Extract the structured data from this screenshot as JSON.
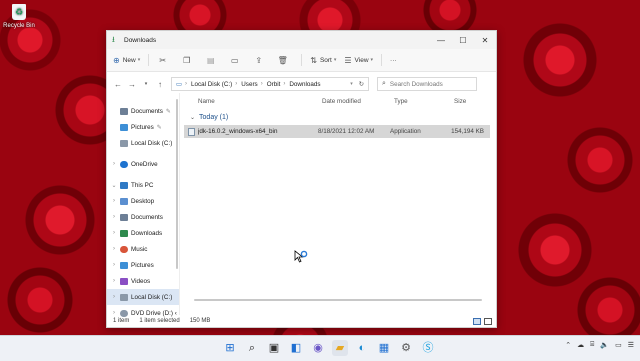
{
  "desktop": {
    "recycle_bin_label": "Recycle Bin"
  },
  "window": {
    "title": "Downloads",
    "controls": {
      "minimize": "—",
      "maximize": "☐",
      "close": "✕"
    }
  },
  "toolbar": {
    "new_label": "New",
    "sort_label": "Sort",
    "view_label": "View",
    "more": "···"
  },
  "address": {
    "segments": [
      "Local Disk (C:)",
      "Users",
      "Orbit",
      "Downloads"
    ],
    "search_placeholder": "Search Downloads"
  },
  "sidebar": {
    "items": [
      {
        "label": "Documents",
        "icon": "documents-icon",
        "color": "#6d7f96",
        "pinned": true
      },
      {
        "label": "Pictures",
        "icon": "pictures-icon",
        "color": "#3d8fd6",
        "pinned": true
      },
      {
        "label": "Local Disk (C:)",
        "icon": "drive-icon",
        "color": "#8a98a8",
        "pinned": false
      },
      {
        "label": "OneDrive",
        "icon": "onedrive-icon",
        "color": "#1e73cf"
      },
      {
        "label": "This PC",
        "icon": "computer-icon",
        "color": "#2f79c4"
      },
      {
        "label": "Desktop",
        "icon": "desktop-icon",
        "color": "#5b8fd0"
      },
      {
        "label": "Documents",
        "icon": "documents-icon",
        "color": "#6d7f96"
      },
      {
        "label": "Downloads",
        "icon": "downloads-icon",
        "color": "#2f8a4e"
      },
      {
        "label": "Music",
        "icon": "music-icon",
        "color": "#d8553a"
      },
      {
        "label": "Pictures",
        "icon": "pictures-icon",
        "color": "#3d8fd6"
      },
      {
        "label": "Videos",
        "icon": "videos-icon",
        "color": "#8a4fc4"
      },
      {
        "label": "Local Disk (C:)",
        "icon": "drive-icon",
        "color": "#8a98a8"
      },
      {
        "label": "DVD Drive (D:) ‹",
        "icon": "dvd-icon",
        "color": "#8a98a8"
      }
    ]
  },
  "columns": {
    "name": "Name",
    "date": "Date modified",
    "type": "Type",
    "size": "Size"
  },
  "group": {
    "label": "Today (1)"
  },
  "files": [
    {
      "name": "jdk-16.0.2_windows-x64_bin",
      "date": "8/18/2021 12:02 AM",
      "type": "Application",
      "size": "154,194 KB"
    }
  ],
  "status": {
    "count": "1 item",
    "selected": "1 item selected",
    "size": "150 MB"
  },
  "taskbar": {
    "apps": [
      {
        "name": "start-icon",
        "glyph": "⊞",
        "color": "#1f6fd1"
      },
      {
        "name": "search-icon",
        "glyph": "⌕",
        "color": "#222222"
      },
      {
        "name": "task-view-icon",
        "glyph": "▣",
        "color": "#333333"
      },
      {
        "name": "widgets-icon",
        "glyph": "◧",
        "color": "#1f6fd1"
      },
      {
        "name": "chat-icon",
        "glyph": "◉",
        "color": "#6b57c7"
      },
      {
        "name": "file-explorer-icon",
        "glyph": "▰",
        "color": "#e6a823"
      },
      {
        "name": "edge-icon",
        "glyph": "◐",
        "color": "#1a8ad2"
      },
      {
        "name": "store-icon",
        "glyph": "▦",
        "color": "#1f6fd1"
      },
      {
        "name": "settings-icon",
        "glyph": "⚙",
        "color": "#555555"
      },
      {
        "name": "skype-icon",
        "glyph": "Ⓢ",
        "color": "#1aa1e0"
      }
    ]
  }
}
